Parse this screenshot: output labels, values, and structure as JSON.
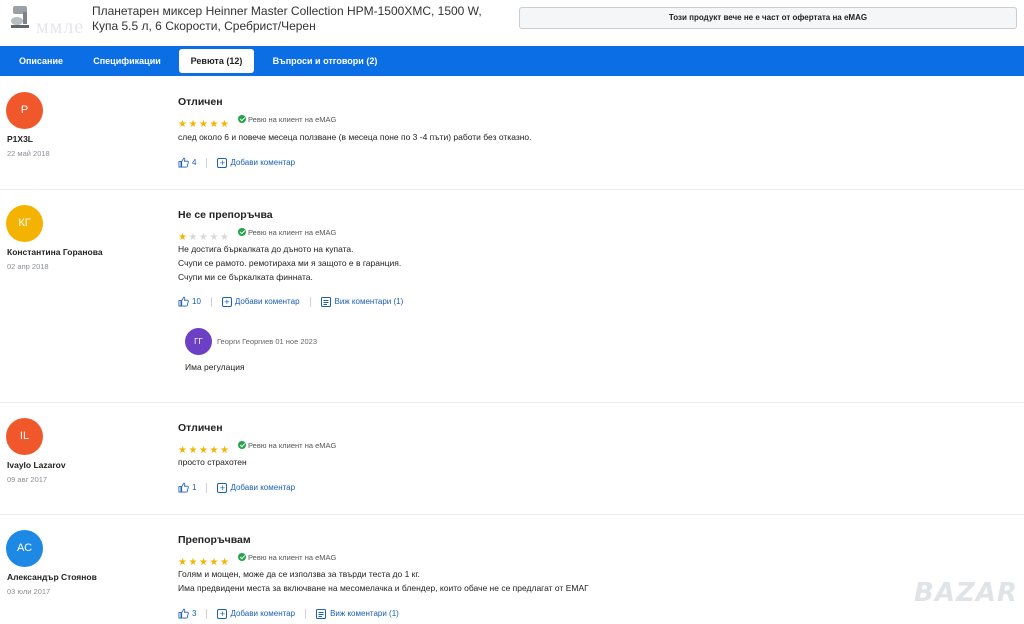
{
  "header": {
    "watermark": "ммле",
    "product_title": "Планетарен миксер Heinner Master Collection HPM-1500XMC, 1500 W, Купа 5.5 л, 6 Скорости, Сребрист/Черен",
    "unavailable_notice": "Този продукт вече не е част от офертата на eMAG"
  },
  "tabs": [
    {
      "label": "Описание",
      "active": false
    },
    {
      "label": "Спецификации",
      "active": false
    },
    {
      "label": "Ревюта (12)",
      "active": true
    },
    {
      "label": "Въпроси и отговори (2)",
      "active": false
    }
  ],
  "common": {
    "verified_label": "Ревю на клиент на eMAG",
    "add_comment_label": "Добави коментар"
  },
  "reviews": [
    {
      "initials": "P",
      "avatar_color": "#f0582c",
      "author": "P1X3L",
      "date": "22 май 2018",
      "title": "Отличен",
      "rating": 5,
      "text_lines": [
        "след около 6 и повече месеца ползване (в месеца поне по 3 -4 пъти) работи без отказно."
      ],
      "likes": "4",
      "view_comments": ""
    },
    {
      "initials": "КГ",
      "avatar_color": "#f5b301",
      "author": "Константина Горанова",
      "date": "02 апр 2018",
      "title": "Не се препоръчва",
      "rating": 1,
      "text_lines": [
        "Не достига бъркалката до дъното на купата.",
        "Счупи се рамото. ремотираха ми я защото е в гаранция.",
        "Счупи ми се бъркалката финната."
      ],
      "likes": "10",
      "view_comments": "Виж коментари (1)",
      "reply": {
        "initials": "ГГ",
        "author": "Георги Георгиев",
        "date": "01 ное 2023",
        "text": "Има регулация"
      }
    },
    {
      "initials": "IL",
      "avatar_color": "#f0582c",
      "author": "Ivaylo Lazarov",
      "date": "09 авг 2017",
      "title": "Отличен",
      "rating": 5,
      "text_lines": [
        "просто страхотен"
      ],
      "likes": "1",
      "view_comments": ""
    },
    {
      "initials": "АС",
      "avatar_color": "#1e88e5",
      "author": "Александър Стоянов",
      "date": "03 юли 2017",
      "title": "Препоръчвам",
      "rating": 5,
      "text_lines": [
        "Голям и мощен, може да се използва за твърди теста до 1 кг.",
        "Има предвидени места за включване на месомелачка и блендер, които обаче не се предлагат от ЕМАГ"
      ],
      "likes": "3",
      "view_comments": "Виж коментари (1)"
    }
  ],
  "site_watermark": "BAZAR"
}
